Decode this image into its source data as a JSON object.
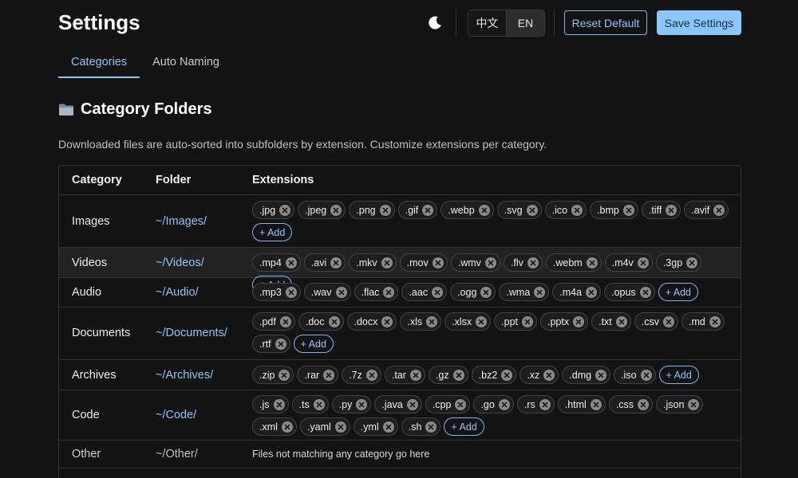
{
  "header": {
    "title": "Settings",
    "lang_zh": "中文",
    "lang_en": "EN",
    "reset_label": "Reset Default",
    "save_label": "Save Settings"
  },
  "tabs": [
    {
      "label": "Categories",
      "active": true
    },
    {
      "label": "Auto Naming",
      "active": false
    }
  ],
  "section": {
    "icon": "folder-icon",
    "title": "Category Folders",
    "description": "Downloaded files are auto-sorted into subfolders by extension. Customize extensions per category."
  },
  "table": {
    "headers": {
      "category": "Category",
      "folder": "Folder",
      "extensions": "Extensions"
    },
    "add_label": "+ Add",
    "rows": [
      {
        "category": "Images",
        "folder": "~/Images/",
        "extensions": [
          ".jpg",
          ".jpeg",
          ".png",
          ".gif",
          ".webp",
          ".svg",
          ".ico",
          ".bmp",
          ".tiff",
          ".avif"
        ]
      },
      {
        "category": "Videos",
        "folder": "~/Videos/",
        "extensions": [
          ".mp4",
          ".avi",
          ".mkv",
          ".mov",
          ".wmv",
          ".flv",
          ".webm",
          ".m4v",
          ".3gp"
        ]
      },
      {
        "category": "Audio",
        "folder": "~/Audio/",
        "extensions": [
          ".mp3",
          ".wav",
          ".flac",
          ".aac",
          ".ogg",
          ".wma",
          ".m4a",
          ".opus"
        ]
      },
      {
        "category": "Documents",
        "folder": "~/Documents/",
        "extensions": [
          ".pdf",
          ".doc",
          ".docx",
          ".xls",
          ".xlsx",
          ".ppt",
          ".pptx",
          ".txt",
          ".csv",
          ".md",
          ".rtf"
        ]
      },
      {
        "category": "Archives",
        "folder": "~/Archives/",
        "extensions": [
          ".zip",
          ".rar",
          ".7z",
          ".tar",
          ".gz",
          ".bz2",
          ".xz",
          ".dmg",
          ".iso"
        ]
      },
      {
        "category": "Code",
        "folder": "~/Code/",
        "extensions": [
          ".js",
          ".ts",
          ".py",
          ".java",
          ".cpp",
          ".go",
          ".rs",
          ".html",
          ".css",
          ".json",
          ".xml",
          ".yaml",
          ".yml",
          ".sh"
        ]
      },
      {
        "category": "Other",
        "folder": "~/Other/",
        "note": "Files not matching any category go here"
      }
    ]
  },
  "colors": {
    "accent": "#8ec4f6",
    "background": "#131313"
  }
}
